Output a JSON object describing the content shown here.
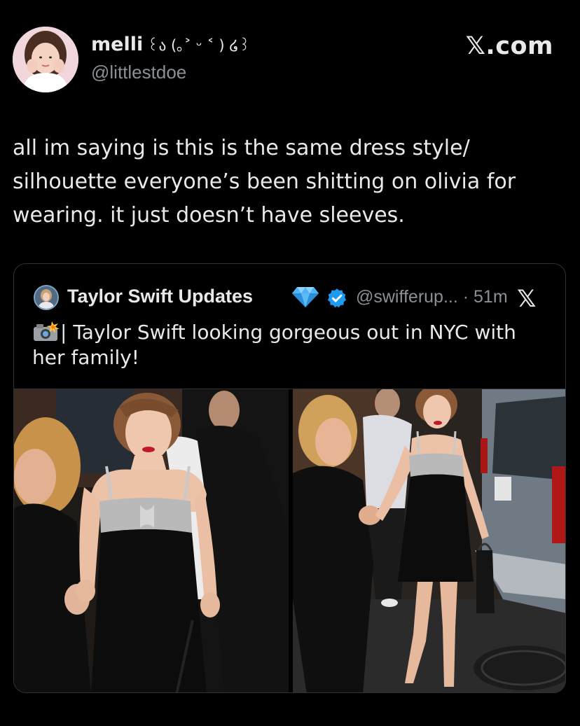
{
  "post": {
    "author_name": "melli",
    "author_emoticon": "꒰ა (｡˃ ᵕ ˂ ) ໒꒱",
    "author_handle": "@littlestdoe",
    "site_label": "𝕏.com",
    "text": "all im saying is this is the same dress style/ silhouette everyone’s been shitting on olivia for wearing. it just doesn’t have sleeves."
  },
  "quoted_post": {
    "author_name": "Taylor Swift Updates",
    "handle_time": "@swifferup... · 51m",
    "text": "| Taylor Swift looking gorgeous out in NYC with her family!",
    "icons": [
      "diamond-icon",
      "verified-badge-icon",
      "camera-flash-icon",
      "x-logo-icon"
    ],
    "photos": [
      "photo-left",
      "photo-right"
    ]
  },
  "colors": {
    "background": "#000000",
    "text_primary": "#e7e9ea",
    "text_secondary": "#8b9096",
    "border": "#2f3336",
    "verified_blue": "#1d9bf0",
    "diamond_blue": "#4fb3f6"
  }
}
